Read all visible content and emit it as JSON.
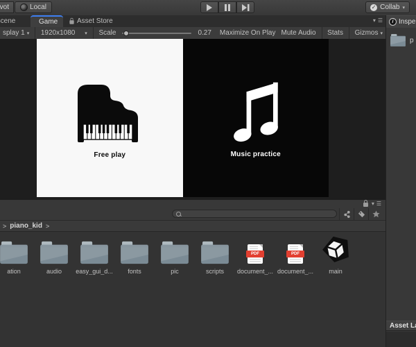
{
  "colors": {
    "accent_blue": "#3e7ff2",
    "pdf_red": "#e23f30",
    "folder_light": "#93a3ad",
    "folder_dark": "#61707b",
    "white_screen": "#f8f8f8",
    "black_screen": "#070707"
  },
  "top_toolbar": {
    "pivot_label": "vot",
    "local_label": "Local",
    "collab_label": "Collab"
  },
  "tabs": [
    {
      "label": "Scene",
      "active": false
    },
    {
      "label": "Game",
      "active": true
    },
    {
      "label": "Asset Store",
      "active": false
    }
  ],
  "game_toolbar": {
    "display_label": "splay 1",
    "resolution": "1920x1080",
    "scale_label": "Scale",
    "scale_value": "0.27",
    "maximize_label": "Maximize On Play",
    "mute_label": "Mute Audio",
    "stats_label": "Stats",
    "gizmos_label": "Gizmos"
  },
  "game_view": {
    "free_play_label": "Free play",
    "music_practice_label": "Music practice"
  },
  "project": {
    "breadcrumb": "piano_kid",
    "pdf_badge": "PDF",
    "items": [
      {
        "name": "ation",
        "type": "folder"
      },
      {
        "name": "audio",
        "type": "folder"
      },
      {
        "name": "easy_gui_d...",
        "type": "folder"
      },
      {
        "name": "fonts",
        "type": "folder"
      },
      {
        "name": "pic",
        "type": "folder"
      },
      {
        "name": "scripts",
        "type": "folder"
      },
      {
        "name": "document_...",
        "type": "pdf"
      },
      {
        "name": "document_...",
        "type": "pdf"
      },
      {
        "name": "main",
        "type": "unity"
      }
    ]
  },
  "inspector": {
    "tab_label": "Inspe",
    "selected_label": "p",
    "asset_labels_label": "Asset La"
  }
}
